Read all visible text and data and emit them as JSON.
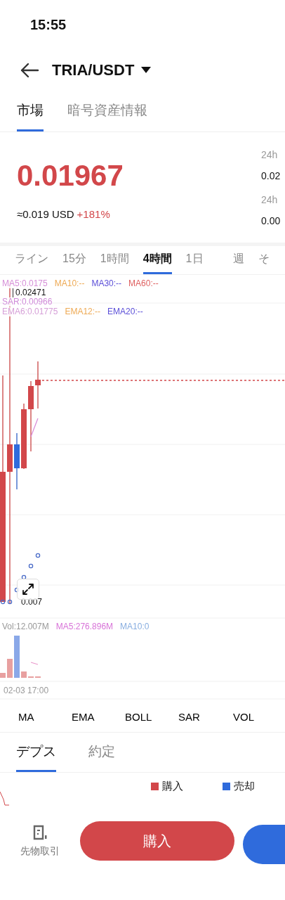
{
  "status_bar": {
    "time": "15:55"
  },
  "header": {
    "pair": "TRIA/USDT"
  },
  "top_tabs": [
    {
      "label": "市場",
      "selected": true
    },
    {
      "label": "暗号資産情報",
      "selected": false
    }
  ],
  "price": {
    "value": "0.01967",
    "approx": "≈0.019 USD",
    "change": "+181%"
  },
  "stats": [
    {
      "label": "24h",
      "value": "0.02"
    },
    {
      "label": "24h",
      "value": "0.00"
    }
  ],
  "intervals": [
    {
      "label": "ライン",
      "selected": false
    },
    {
      "label": "15分",
      "selected": false
    },
    {
      "label": "1時間",
      "selected": false
    },
    {
      "label": "4時間",
      "selected": true
    },
    {
      "label": "1日",
      "selected": false
    },
    {
      "label": "週",
      "selected": false
    },
    {
      "label": "そ",
      "selected": false
    }
  ],
  "chart": {
    "legend_rows": [
      [
        {
          "text": "MA5:0.0175",
          "color": "#d68fd8"
        },
        {
          "text": "MA10:--",
          "color": "#eeaa55"
        },
        {
          "text": "MA30:--",
          "color": "#5b4fd8"
        },
        {
          "text": "MA60:--",
          "color": "#de5f5f"
        }
      ],
      [
        {
          "text": "SAR:0.00966",
          "color": "#cf8ad8"
        }
      ],
      [
        {
          "text": "EMA6:0.01775",
          "color": "#d6a0d8"
        },
        {
          "text": "EMA12:--",
          "color": "#eeaa55"
        },
        {
          "text": "EMA20:--",
          "color": "#5b4fd8"
        }
      ]
    ],
    "high_label": "0.02471",
    "low_label": "0.007",
    "volume_legend": [
      {
        "text": "Vol:12.007M",
        "color": "#999999"
      },
      {
        "text": "MA5:276.896M",
        "color": "#d873d8"
      },
      {
        "text": "MA10:0",
        "color": "#88aee0"
      }
    ],
    "time_label": "02-03 17:00"
  },
  "indicators": [
    "MA",
    "EMA",
    "BOLL",
    "SAR",
    "VOL"
  ],
  "depth_tabs": [
    {
      "label": "デプス",
      "selected": true
    },
    {
      "label": "約定",
      "selected": false
    }
  ],
  "depth_legend": [
    {
      "label": "購入",
      "color": "#d2474a"
    },
    {
      "label": "売却",
      "color": "#2f6bdc"
    }
  ],
  "bottom": {
    "futures_label": "先物取引",
    "buy_label": "購入"
  }
}
